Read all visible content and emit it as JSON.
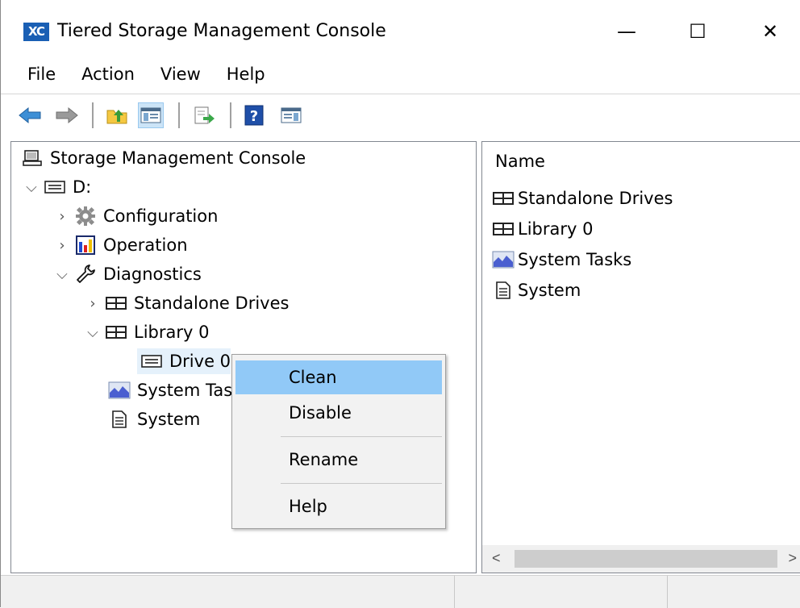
{
  "window": {
    "icon_text": "XC",
    "title": "Tiered Storage Management Console",
    "minimize": "—",
    "maximize": "☐",
    "close": "✕"
  },
  "menu": [
    "File",
    "Action",
    "View",
    "Help"
  ],
  "toolbar": {
    "items": [
      "back-icon",
      "forward-icon",
      "up-folder-icon",
      "show-hide-tree-icon",
      "export-list-icon",
      "help-icon",
      "show-hide-action-pane-icon"
    ]
  },
  "tree": {
    "root": "Storage Management Console",
    "drive": "D:",
    "configuration": "Configuration",
    "operation": "Operation",
    "diagnostics": "Diagnostics",
    "standalone_drives": "Standalone Drives",
    "library": "Library 0",
    "drive0": "Drive 0",
    "system_tasks": "System Tasks",
    "system": "System"
  },
  "list": {
    "header": "Name",
    "items": [
      "Standalone Drives",
      "Library 0",
      "System Tasks",
      "System"
    ]
  },
  "context_menu": {
    "items": [
      "Clean",
      "Disable",
      "Rename",
      "Help"
    ],
    "highlighted": "Clean"
  },
  "colors": {
    "selection": "#e5f1fb",
    "menu_highlight": "#91c9f7",
    "app_icon": "#1a5fb4"
  }
}
